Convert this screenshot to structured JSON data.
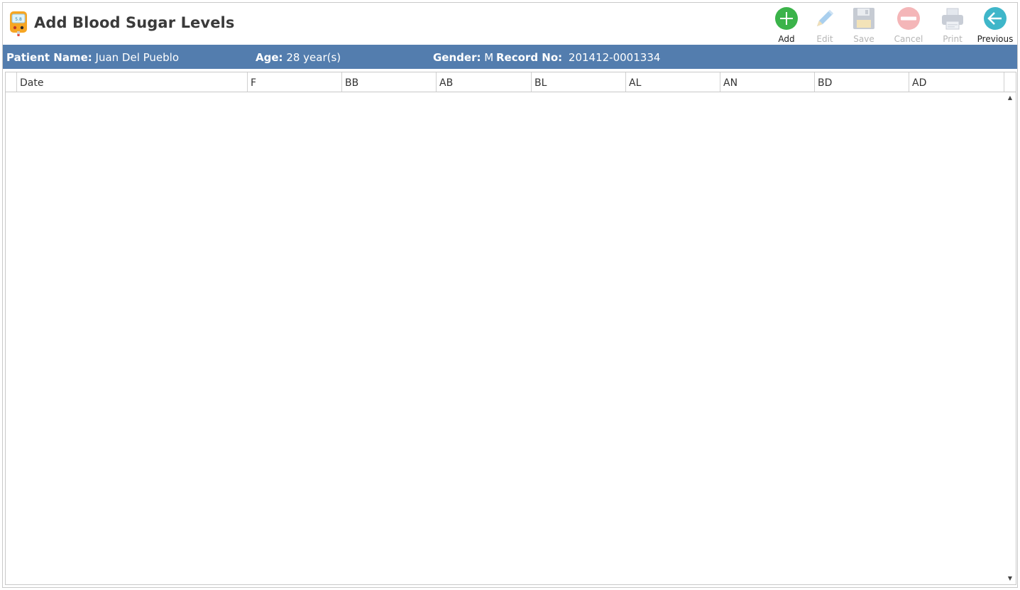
{
  "window": {
    "title": "Add Blood Sugar Levels"
  },
  "toolbar": {
    "add": "Add",
    "edit": "Edit",
    "save": "Save",
    "cancel": "Cancel",
    "print": "Print",
    "previous": "Previous"
  },
  "patient": {
    "name_label": "Patient Name:",
    "name_value": "Juan Del Pueblo",
    "age_label": "Age:",
    "age_value": "28 year(s)",
    "gender_label": "Gender:",
    "gender_value": "M",
    "record_label": "Record No:",
    "record_value": "201412-0001334"
  },
  "grid": {
    "columns": [
      "Date",
      "F",
      "BB",
      "AB",
      "BL",
      "AL",
      "AN",
      "BD",
      "AD"
    ],
    "rows": []
  },
  "colors": {
    "patient_bar": "#537dae",
    "add": "#3bb34a",
    "edit_disabled": "#a9cfee",
    "save_disabled": "#c6cbd3",
    "cancel_disabled": "#f4b6b8",
    "print_disabled": "#c8cdd6",
    "previous": "#3fb6c9"
  }
}
